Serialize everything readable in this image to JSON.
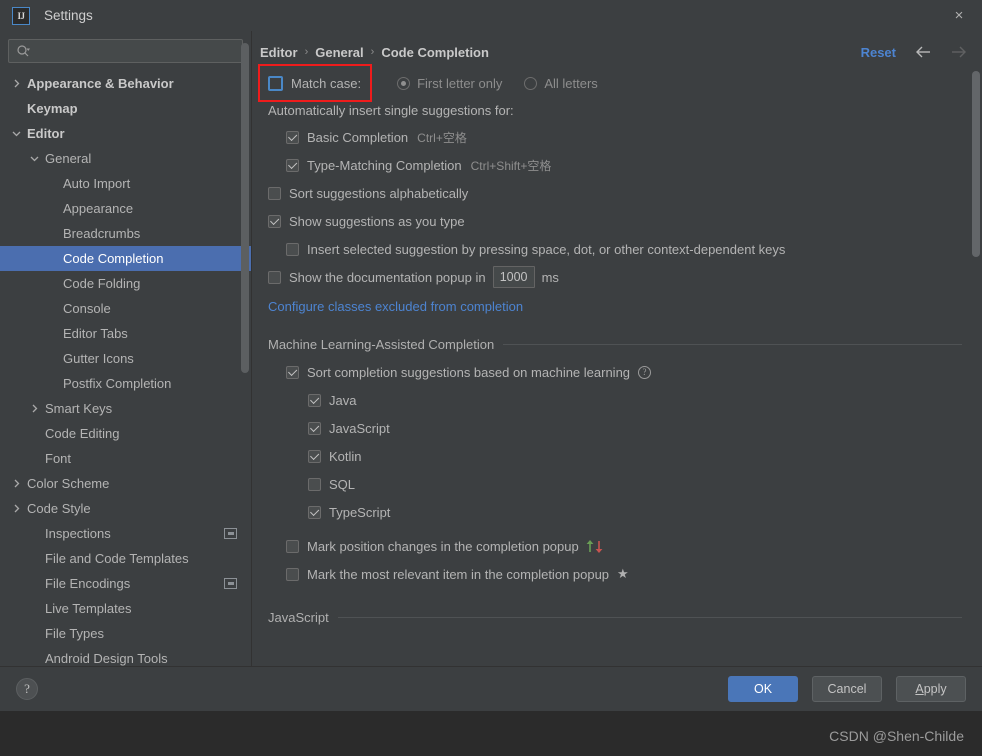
{
  "window": {
    "title": "Settings",
    "logo_text": "IJ",
    "close_icon": "×"
  },
  "sidebar": {
    "search": {
      "placeholder": "",
      "value": "",
      "icon": "search-icon"
    },
    "items": [
      {
        "label": "Appearance & Behavior",
        "level": 0,
        "arrow": "right",
        "bold": true,
        "selected": false,
        "badge": false
      },
      {
        "label": "Keymap",
        "level": 0,
        "arrow": "none",
        "bold": true,
        "selected": false,
        "badge": false
      },
      {
        "label": "Editor",
        "level": 0,
        "arrow": "down",
        "bold": true,
        "selected": false,
        "badge": false
      },
      {
        "label": "General",
        "level": 1,
        "arrow": "down",
        "bold": false,
        "selected": false,
        "badge": false
      },
      {
        "label": "Auto Import",
        "level": 2,
        "arrow": "none",
        "bold": false,
        "selected": false,
        "badge": false
      },
      {
        "label": "Appearance",
        "level": 2,
        "arrow": "none",
        "bold": false,
        "selected": false,
        "badge": false
      },
      {
        "label": "Breadcrumbs",
        "level": 2,
        "arrow": "none",
        "bold": false,
        "selected": false,
        "badge": false
      },
      {
        "label": "Code Completion",
        "level": 2,
        "arrow": "none",
        "bold": false,
        "selected": true,
        "badge": false
      },
      {
        "label": "Code Folding",
        "level": 2,
        "arrow": "none",
        "bold": false,
        "selected": false,
        "badge": false
      },
      {
        "label": "Console",
        "level": 2,
        "arrow": "none",
        "bold": false,
        "selected": false,
        "badge": false
      },
      {
        "label": "Editor Tabs",
        "level": 2,
        "arrow": "none",
        "bold": false,
        "selected": false,
        "badge": false
      },
      {
        "label": "Gutter Icons",
        "level": 2,
        "arrow": "none",
        "bold": false,
        "selected": false,
        "badge": false
      },
      {
        "label": "Postfix Completion",
        "level": 2,
        "arrow": "none",
        "bold": false,
        "selected": false,
        "badge": false
      },
      {
        "label": "Smart Keys",
        "level": 1,
        "arrow": "right",
        "bold": false,
        "selected": false,
        "badge": false
      },
      {
        "label": "Code Editing",
        "level": 1,
        "arrow": "none",
        "bold": false,
        "selected": false,
        "badge": false
      },
      {
        "label": "Font",
        "level": 1,
        "arrow": "none",
        "bold": false,
        "selected": false,
        "badge": false
      },
      {
        "label": "Color Scheme",
        "level": 0,
        "arrow": "right",
        "bold": false,
        "selected": false,
        "badge": false
      },
      {
        "label": "Code Style",
        "level": 0,
        "arrow": "right",
        "bold": false,
        "selected": false,
        "badge": false
      },
      {
        "label": "Inspections",
        "level": 1,
        "arrow": "none",
        "bold": false,
        "selected": false,
        "badge": true
      },
      {
        "label": "File and Code Templates",
        "level": 1,
        "arrow": "none",
        "bold": false,
        "selected": false,
        "badge": false
      },
      {
        "label": "File Encodings",
        "level": 1,
        "arrow": "none",
        "bold": false,
        "selected": false,
        "badge": true
      },
      {
        "label": "Live Templates",
        "level": 1,
        "arrow": "none",
        "bold": false,
        "selected": false,
        "badge": false
      },
      {
        "label": "File Types",
        "level": 1,
        "arrow": "none",
        "bold": false,
        "selected": false,
        "badge": false
      },
      {
        "label": "Android Design Tools",
        "level": 1,
        "arrow": "none",
        "bold": false,
        "selected": false,
        "badge": false
      }
    ]
  },
  "breadcrumb": {
    "crumbs": [
      "Editor",
      "General",
      "Code Completion"
    ],
    "separator": "›",
    "reset_label": "Reset",
    "back_icon": "arrow-left-icon",
    "forward_icon": "arrow-right-icon"
  },
  "main": {
    "match_case": {
      "label": "Match case:",
      "checked": false,
      "focused": true,
      "options": [
        {
          "label": "First letter only",
          "selected": true
        },
        {
          "label": "All letters",
          "selected": false
        }
      ]
    },
    "auto_insert_header": "Automatically insert single suggestions for:",
    "auto_insert": [
      {
        "label": "Basic Completion",
        "shortcut": "Ctrl+空格",
        "checked": true
      },
      {
        "label": "Type-Matching Completion",
        "shortcut": "Ctrl+Shift+空格",
        "checked": true
      }
    ],
    "sort_alphabetically": {
      "label": "Sort suggestions alphabetically",
      "checked": false
    },
    "show_as_you_type": {
      "label": "Show suggestions as you type",
      "checked": true
    },
    "insert_selected": {
      "label": "Insert selected suggestion by pressing space, dot, or other context-dependent keys",
      "checked": false
    },
    "doc_popup": {
      "label_before": "Show the documentation popup in",
      "value": "1000",
      "unit": "ms",
      "checked": false
    },
    "configure_link": "Configure classes excluded from completion",
    "ml_group_title": "Machine Learning-Assisted Completion",
    "ml_sort": {
      "label": "Sort completion suggestions based on machine learning",
      "checked": true,
      "help_icon": "help-circle-icon",
      "help_glyph": "?"
    },
    "ml_languages": [
      {
        "label": "Java",
        "checked": true
      },
      {
        "label": "JavaScript",
        "checked": true
      },
      {
        "label": "Kotlin",
        "checked": true
      },
      {
        "label": "SQL",
        "checked": false
      },
      {
        "label": "TypeScript",
        "checked": true
      }
    ],
    "mark_position": {
      "label": "Mark position changes in the completion popup",
      "checked": false,
      "up_arrow_color": "#6a9e55",
      "down_arrow_color": "#c75450"
    },
    "mark_relevant": {
      "label": "Mark the most relevant item in the completion popup",
      "checked": false,
      "star": "★"
    },
    "js_group_title": "JavaScript"
  },
  "footer": {
    "help_glyph": "?",
    "ok_label": "OK",
    "cancel_label": "Cancel",
    "apply_label_first": "A",
    "apply_label_rest": "pply"
  },
  "watermark": "CSDN @Shen-Childe",
  "colors": {
    "accent_blue": "#4a76b8",
    "link_blue": "#4d84d1",
    "selection_blue": "#4b6eaf",
    "highlight_red": "#ef1c1c",
    "panel_bg": "#3c3f41",
    "desktop_bg": "#2b2b2b"
  }
}
